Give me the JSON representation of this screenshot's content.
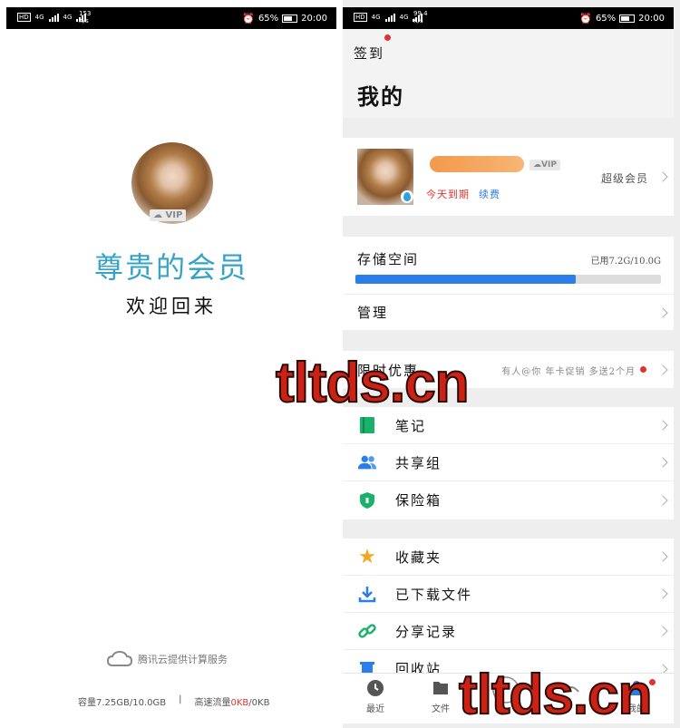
{
  "left": {
    "status": {
      "net": "4G",
      "speed_top": "153",
      "speed_bottom": "K/s",
      "battery": "65%",
      "time": "20:00"
    },
    "vip_badge": "VIP",
    "title": "尊贵的会员",
    "subtitle": "欢迎回来",
    "footer": {
      "service": "腾讯云提供计算服务",
      "quota_label": "容量7.25GB/10.0GB",
      "separator": "|",
      "traffic_label": "高速流量",
      "traffic_used": "0KB",
      "traffic_total": "/0KB"
    }
  },
  "right": {
    "status": {
      "net": "4G",
      "speed_top": "99.4",
      "speed_bottom": "K/s",
      "battery": "65%",
      "time": "20:00"
    },
    "signin": "签到",
    "page_title": "我的",
    "profile": {
      "vip_badge": "VIP",
      "expire": "今天到期",
      "renew": "续费",
      "member_type": "超级会员"
    },
    "storage": {
      "label": "存储空间",
      "usage": "已用7.2G/10.0G",
      "fraction": 0.72
    },
    "manage": "管理",
    "promo": {
      "label": "限时优惠",
      "text": "有人@你 年卡促销 多送2个月"
    },
    "menu1": [
      {
        "label": "笔记",
        "icon": "note-icon"
      },
      {
        "label": "共享组",
        "icon": "group-icon"
      },
      {
        "label": "保险箱",
        "icon": "safe-icon"
      }
    ],
    "menu2": [
      {
        "label": "收藏夹",
        "icon": "star-icon"
      },
      {
        "label": "已下载文件",
        "icon": "download-icon"
      },
      {
        "label": "分享记录",
        "icon": "share-link-icon"
      },
      {
        "label": "回收站",
        "icon": "trash-icon"
      }
    ],
    "nav": [
      {
        "label": "最近",
        "icon": "clock-icon"
      },
      {
        "label": "文件",
        "icon": "folder-icon"
      },
      {
        "label": "",
        "icon": "transfer-icon"
      },
      {
        "label": "",
        "icon": "album-icon"
      },
      {
        "label": "我的",
        "icon": "user-icon"
      }
    ]
  },
  "watermark": "tltds.cn",
  "colors": {
    "accent": "#35a3c7",
    "progress": "#2b7de9",
    "red": "#e3322c",
    "green": "#18b26b",
    "blue": "#2b7de9"
  }
}
